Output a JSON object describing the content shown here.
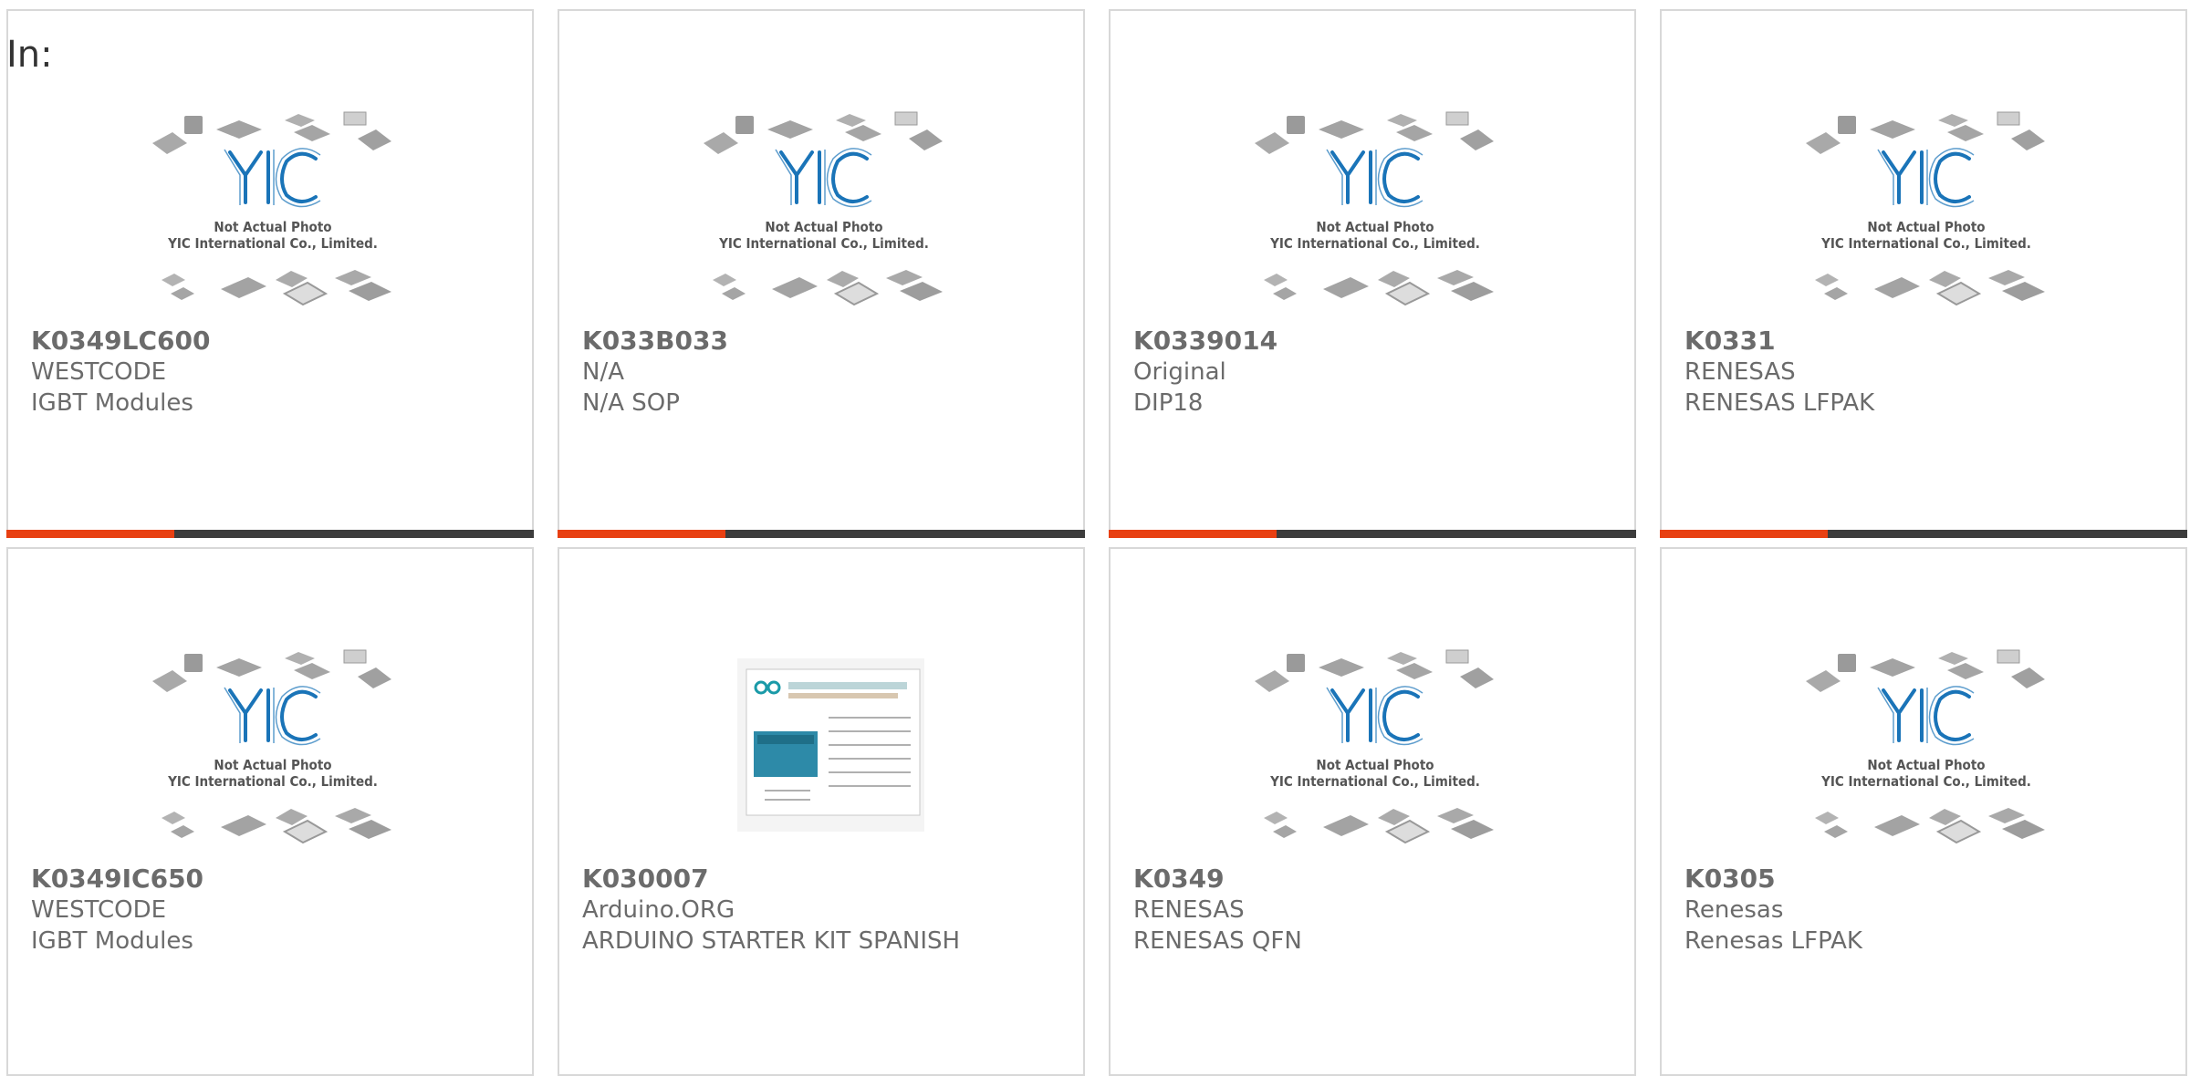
{
  "filter": {
    "label": "In:"
  },
  "placeholder_image": {
    "brand": "YIC",
    "caption_line1": "Not Actual Photo",
    "caption_line2": "YIC International Co., Limited."
  },
  "colors": {
    "accent": "#e84012",
    "bar": "#3c3c3c",
    "brand_blue": "#1a74b8"
  },
  "products": [
    {
      "part": "K0349LC600",
      "maker": "WESTCODE",
      "desc": "IGBT Modules",
      "image": "placeholder",
      "progress_bar": true
    },
    {
      "part": "K033B033",
      "maker": "N/A",
      "desc": "N/A SOP",
      "image": "placeholder",
      "progress_bar": true
    },
    {
      "part": "K0339014",
      "maker": "Original",
      "desc": "DIP18",
      "image": "placeholder",
      "progress_bar": true
    },
    {
      "part": "K0331",
      "maker": "RENESAS",
      "desc": "RENESAS LFPAK",
      "image": "placeholder",
      "progress_bar": true
    },
    {
      "part": "K0349IC650",
      "maker": "WESTCODE",
      "desc": "IGBT Modules",
      "image": "placeholder",
      "progress_bar": false
    },
    {
      "part": "K030007",
      "maker": "Arduino.ORG",
      "desc": "ARDUINO STARTER KIT SPANISH",
      "image": "arduino-kit",
      "progress_bar": false
    },
    {
      "part": "K0349",
      "maker": "RENESAS",
      "desc": "RENESAS QFN",
      "image": "placeholder",
      "progress_bar": false
    },
    {
      "part": "K0305",
      "maker": "Renesas",
      "desc": "Renesas LFPAK",
      "image": "placeholder",
      "progress_bar": false
    }
  ]
}
